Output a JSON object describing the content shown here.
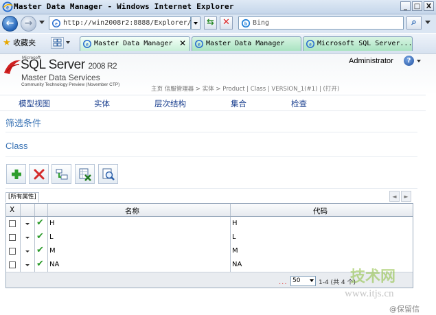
{
  "window": {
    "title": "Master Data Manager - Windows Internet Explorer",
    "controls": [
      "_",
      "□",
      "X"
    ]
  },
  "addressbar": {
    "url": "http://win2008r2:8888/Explorer/",
    "search_placeholder": "Bing"
  },
  "tabbar": {
    "favorites_label": "收藏夹",
    "tabs": [
      {
        "label": "Master Data Manager",
        "active": true
      },
      {
        "label": "Master Data Manager",
        "active": false
      },
      {
        "label": "Microsoft SQL Server...",
        "active": false
      }
    ]
  },
  "header": {
    "ms_label": "Microsoft",
    "product": "SQL Server",
    "version": "2008 R2",
    "subtitle": "Master Data Services",
    "ctp": "Community Technology Preview (November CTP)",
    "breadcrumb": "主页  信服管理器 > 实体 > Product | Class | VERSION_1(#1) | (打开)",
    "user": "Administrator",
    "help_icon": "?"
  },
  "menu": [
    "模型视图",
    "实体",
    "层次结构",
    "集合",
    "检查"
  ],
  "filter_title": "筛选条件",
  "entity_title": "Class",
  "grid": {
    "tab_label": "[所有属性]",
    "pager_prev": "◄",
    "pager_next": "►",
    "header_x": "X",
    "columns": [
      "名称",
      "代码"
    ],
    "rows": [
      {
        "name": "H",
        "code": "H"
      },
      {
        "name": "L",
        "code": "L"
      },
      {
        "name": "M",
        "code": "M"
      },
      {
        "name": "NA",
        "code": "NA"
      }
    ],
    "page_size": "50",
    "page_info": "1-4 (共 4 个)",
    "dots": "..."
  },
  "watermark": {
    "brand": "技术网",
    "site": "www.itjs.cn",
    "credit": "@保留信"
  }
}
